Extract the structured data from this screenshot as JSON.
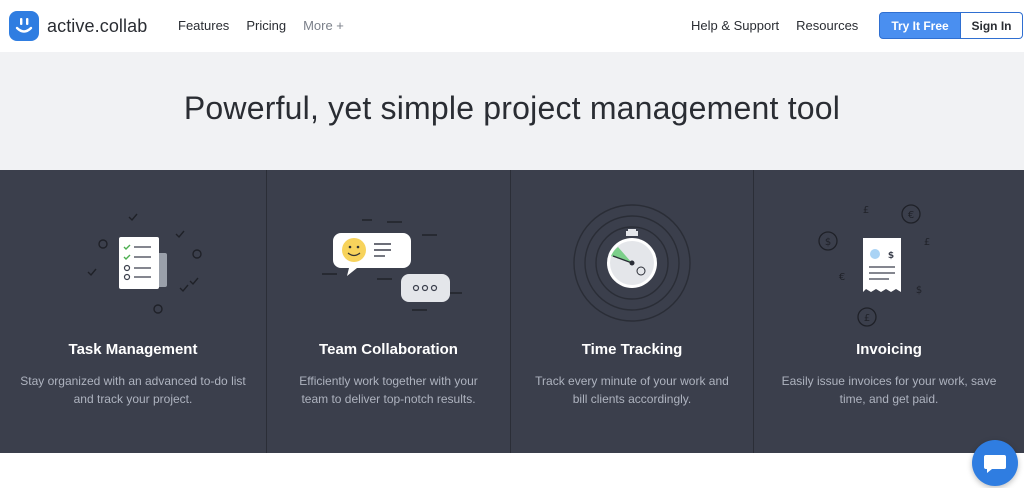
{
  "header": {
    "logo_text": "active.collab",
    "nav_left": [
      "Features",
      "Pricing",
      "More +"
    ],
    "nav_right": [
      "Help & Support",
      "Resources"
    ],
    "try_label": "Try It Free",
    "signin_label": "Sign In"
  },
  "hero": {
    "title": "Powerful, yet simple project management tool"
  },
  "features": [
    {
      "title": "Task Management",
      "desc": "Stay organized with an advanced to-do list and track your project."
    },
    {
      "title": "Team Collaboration",
      "desc": "Efficiently work together with your team to deliver top-notch results."
    },
    {
      "title": "Time Tracking",
      "desc": "Track every minute of your work and bill clients accordingly."
    },
    {
      "title": "Invoicing",
      "desc": "Easily issue invoices for your work, save time, and get paid."
    }
  ],
  "icons": {
    "logo": "smiley-logo-icon",
    "chat": "chat-bubble-icon"
  },
  "colors": {
    "accent": "#4a8ff0",
    "band": "#3b3f4c"
  }
}
